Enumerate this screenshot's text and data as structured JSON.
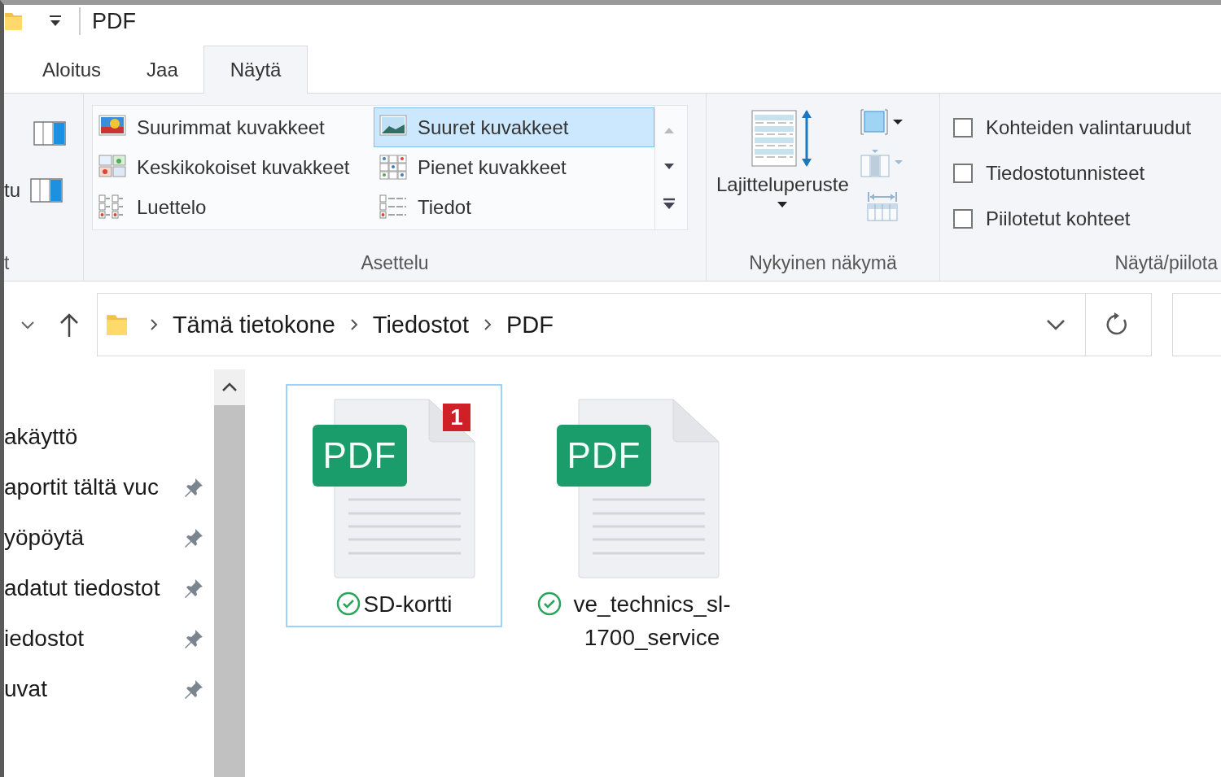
{
  "window": {
    "title": "PDF"
  },
  "tabs": [
    {
      "label": "Aloitus",
      "selected": false
    },
    {
      "label": "Jaa",
      "selected": false
    },
    {
      "label": "Näytä",
      "selected": true
    }
  ],
  "ribbon": {
    "panes_group": {
      "pane_label": "tu",
      "group_label": "t"
    },
    "layout_group": {
      "label": "Asettelu",
      "options": [
        {
          "label": "Suurimmat kuvakkeet",
          "kind": "extra-large",
          "selected": false
        },
        {
          "label": "Suuret kuvakkeet",
          "kind": "large",
          "selected": true
        },
        {
          "label": "Keskikokoiset kuvakkeet",
          "kind": "medium",
          "selected": false
        },
        {
          "label": "Pienet kuvakkeet",
          "kind": "small",
          "selected": false
        },
        {
          "label": "Luettelo",
          "kind": "list",
          "selected": false
        },
        {
          "label": "Tiedot",
          "kind": "details",
          "selected": false
        }
      ]
    },
    "current_view_group": {
      "label": "Nykyinen näkymä",
      "sort_button": "Lajitteluperuste"
    },
    "show_hide_group": {
      "label": "Näytä/piilota",
      "checkboxes": [
        {
          "label": "Kohteiden valintaruudut",
          "checked": false
        },
        {
          "label": "Tiedostotunnisteet",
          "checked": false
        },
        {
          "label": "Piilotetut kohteet",
          "checked": false
        }
      ]
    }
  },
  "address_bar": {
    "breadcrumbs": [
      "Tämä tietokone",
      "Tiedostot",
      "PDF"
    ]
  },
  "navigation": {
    "items": [
      {
        "label": "akäyttö",
        "pinned": false
      },
      {
        "label": "aportit tältä vuc",
        "pinned": true
      },
      {
        "label": "yöpöytä",
        "pinned": true
      },
      {
        "label": "adatut tiedostot",
        "pinned": true
      },
      {
        "label": "iedostot",
        "pinned": true
      },
      {
        "label": "uvat",
        "pinned": true
      }
    ]
  },
  "files": [
    {
      "name": "SD-kortti",
      "type_label": "PDF",
      "badge": "1",
      "synced": true,
      "selected": true
    },
    {
      "name": "ve_technics_sl-1700_service",
      "type_label": "PDF",
      "synced": true,
      "selected": false
    }
  ]
}
